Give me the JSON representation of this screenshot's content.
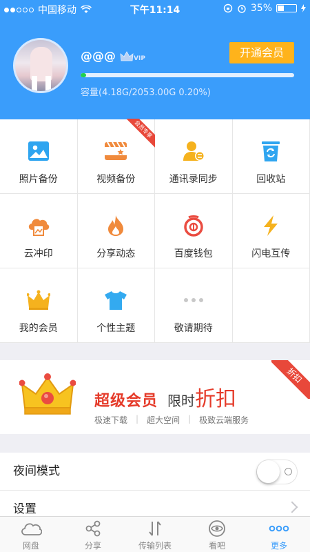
{
  "status_bar": {
    "carrier": "中国移动",
    "time": "下午11:14",
    "battery": "35%",
    "battery_level": 0.35
  },
  "profile": {
    "username": "@@@",
    "vip_badge": "VIP",
    "open_vip_button": "开通会员",
    "capacity_text": "容量(4.18G/2053.00G 0.20%)",
    "usage_fraction": 0.002
  },
  "grid": {
    "items": [
      {
        "label": "照片备份",
        "icon": "photo-icon"
      },
      {
        "label": "视频备份",
        "icon": "video-icon",
        "ribbon": "会员专享"
      },
      {
        "label": "通讯录同步",
        "icon": "contacts-sync-icon"
      },
      {
        "label": "回收站",
        "icon": "recycle-bin-icon"
      },
      {
        "label": "云冲印",
        "icon": "cloud-print-icon"
      },
      {
        "label": "分享动态",
        "icon": "flame-icon"
      },
      {
        "label": "百度钱包",
        "icon": "wallet-icon"
      },
      {
        "label": "闪电互传",
        "icon": "lightning-icon"
      },
      {
        "label": "我的会员",
        "icon": "crown-icon"
      },
      {
        "label": "个性主题",
        "icon": "tshirt-icon"
      },
      {
        "label": "敬请期待",
        "icon": "more-dots-icon"
      }
    ]
  },
  "banner": {
    "title_bold": "超级会员",
    "title_mid": "限时",
    "title_big": "折扣",
    "features": [
      "极速下载",
      "超大空间",
      "极致云端服务"
    ],
    "ribbon": "折扣"
  },
  "settings": {
    "night_mode_label": "夜间模式",
    "night_mode_on": false,
    "settings_label": "设置"
  },
  "tabbar": {
    "tabs": [
      {
        "label": "网盘",
        "icon": "cloud-icon"
      },
      {
        "label": "分享",
        "icon": "share-icon"
      },
      {
        "label": "传输列表",
        "icon": "transfer-icon"
      },
      {
        "label": "看吧",
        "icon": "eye-icon"
      },
      {
        "label": "更多",
        "icon": "more-icon",
        "active": true
      }
    ]
  },
  "colors": {
    "primary": "#3a9dfb",
    "vip_orange": "#ffb31b",
    "accent_red": "#e53b2a",
    "progress_green": "#1fd04f"
  }
}
